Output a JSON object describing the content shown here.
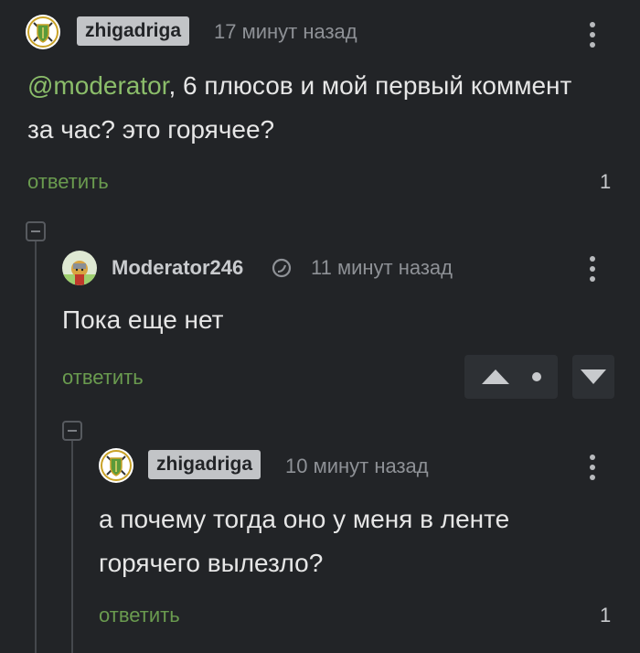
{
  "comments": [
    {
      "username": "zhigadriga",
      "time": "17 минут назад",
      "mention": "@moderator",
      "text": ", 6 плюсов и мой первый коммент за час? это горячее?",
      "reply_label": "ответить",
      "replies_count": "1"
    },
    {
      "username": "Moderator246",
      "time": "11 минут назад",
      "text": "Пока еще нет",
      "reply_label": "ответить"
    },
    {
      "username": "zhigadriga",
      "time": "10 минут назад",
      "text": "а почему тогда оно у меня в ленте горячего вылезло?",
      "reply_label": "ответить",
      "replies_count": "1"
    }
  ],
  "colors": {
    "background": "#222427",
    "mention": "#8bbd6a",
    "reply": "#6a9b4f",
    "badge": "#c2c4c7"
  },
  "icons": {
    "avatar_user": "shield-crest-icon",
    "avatar_moderator": "knight-icon",
    "moderator_badge": "moon-badge-icon",
    "more": "vertical-dots-icon",
    "upvote": "triangle-up-icon",
    "downvote": "triangle-down-icon",
    "collapse": "minus-box-icon"
  }
}
